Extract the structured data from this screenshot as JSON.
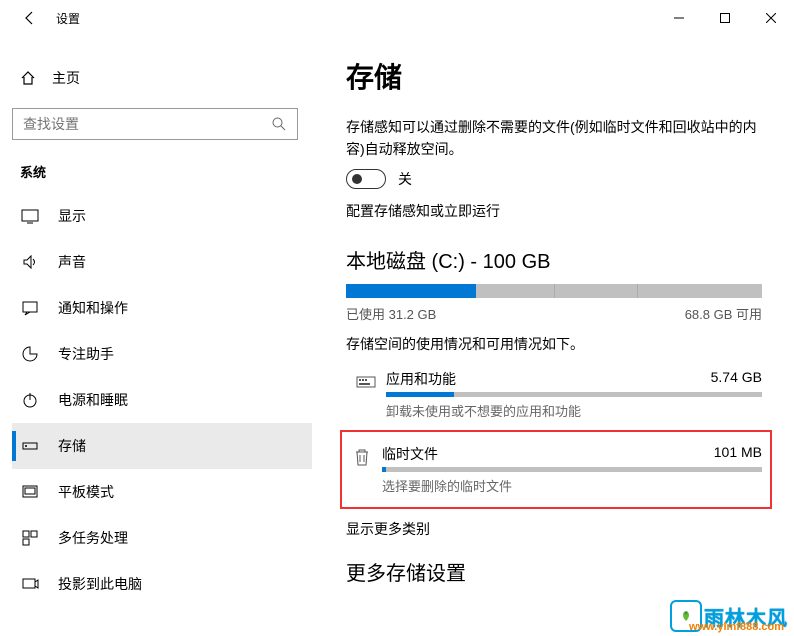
{
  "window": {
    "title": "设置"
  },
  "sidebar": {
    "home": "主页",
    "search_placeholder": "查找设置",
    "section": "系统",
    "items": [
      {
        "label": "显示"
      },
      {
        "label": "声音"
      },
      {
        "label": "通知和操作"
      },
      {
        "label": "专注助手"
      },
      {
        "label": "电源和睡眠"
      },
      {
        "label": "存储"
      },
      {
        "label": "平板模式"
      },
      {
        "label": "多任务处理"
      },
      {
        "label": "投影到此电脑"
      }
    ]
  },
  "content": {
    "title": "存储",
    "sense_desc": "存储感知可以通过删除不需要的文件(例如临时文件和回收站中的内容)自动释放空间。",
    "toggle_state": "关",
    "configure_link": "配置存储感知或立即运行",
    "disk_title": "本地磁盘 (C:) - 100 GB",
    "used_label": "已使用 31.2 GB",
    "free_label": "68.8 GB 可用",
    "usage_desc": "存储空间的使用情况和可用情况如下。",
    "items": [
      {
        "name": "应用和功能",
        "size": "5.74 GB",
        "sub": "卸载未使用或不想要的应用和功能",
        "fill_pct": 18
      },
      {
        "name": "临时文件",
        "size": "101 MB",
        "sub": "选择要删除的临时文件",
        "fill_pct": 1
      }
    ],
    "show_more": "显示更多类别",
    "more_title": "更多存储设置"
  },
  "watermark": {
    "brand": "雨林木风",
    "url": "www.ylmf888.com"
  },
  "colors": {
    "accent": "#0078d4",
    "highlight": "#e33"
  }
}
